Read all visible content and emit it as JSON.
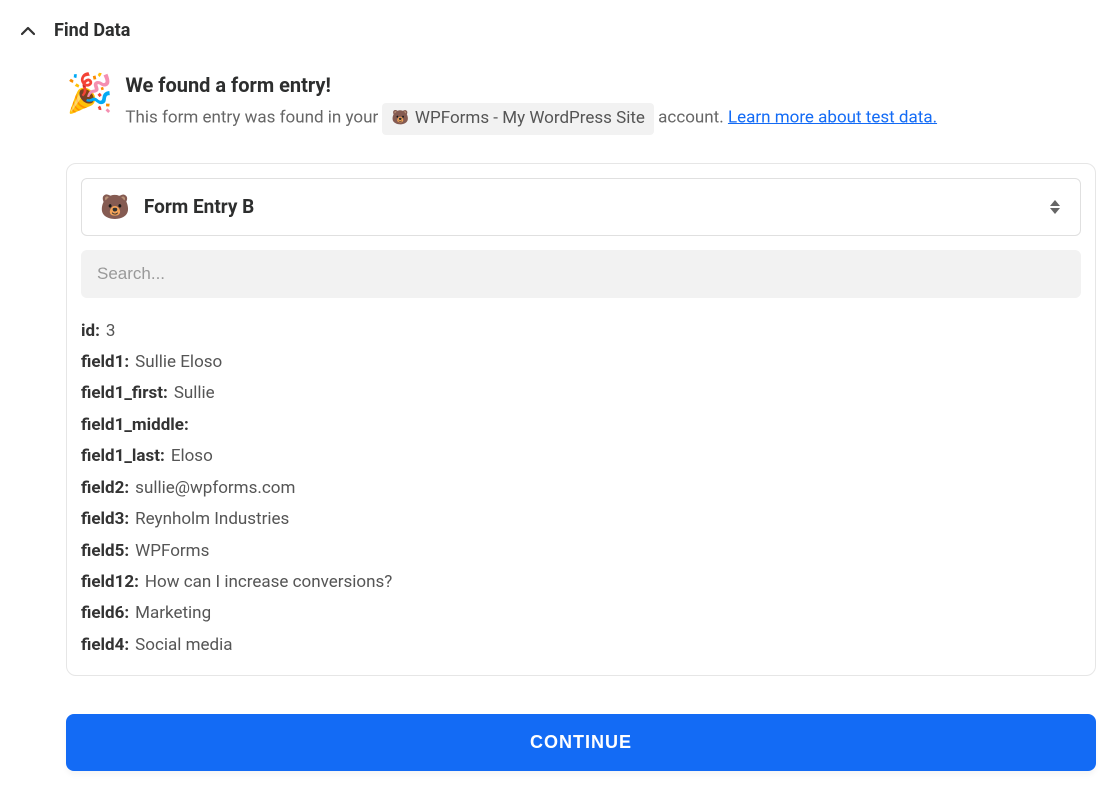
{
  "section": {
    "title": "Find Data"
  },
  "found": {
    "title": "We found a form entry!",
    "subtitle_pre": "This form entry was found in your ",
    "account_chip": "WPForms - My WordPress Site",
    "subtitle_post": " account. ",
    "learn_link": "Learn more about test data."
  },
  "dropdown": {
    "label": "Form Entry B"
  },
  "search": {
    "placeholder": "Search..."
  },
  "fields": [
    {
      "key": "id:",
      "value": "3"
    },
    {
      "key": "field1:",
      "value": "Sullie Eloso"
    },
    {
      "key": "field1_first:",
      "value": "Sullie"
    },
    {
      "key": "field1_middle:",
      "value": ""
    },
    {
      "key": "field1_last:",
      "value": "Eloso"
    },
    {
      "key": "field2:",
      "value": "sullie@wpforms.com"
    },
    {
      "key": "field3:",
      "value": "Reynholm Industries"
    },
    {
      "key": "field5:",
      "value": "WPForms"
    },
    {
      "key": "field12:",
      "value": "How can I increase conversions?"
    },
    {
      "key": "field6:",
      "value": "Marketing"
    },
    {
      "key": "field4:",
      "value": "Social media"
    }
  ],
  "continue_label": "CONTINUE"
}
